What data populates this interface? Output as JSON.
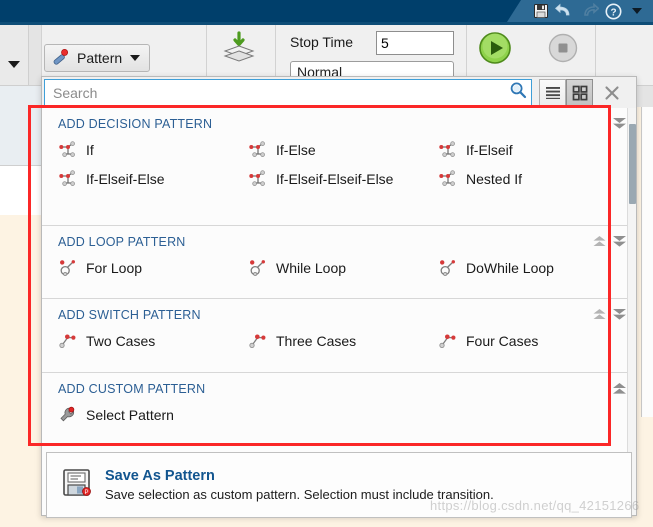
{
  "titlebar": {
    "quick_access": [
      {
        "name": "save-icon",
        "label": "Save"
      },
      {
        "name": "undo-icon",
        "label": "Undo"
      },
      {
        "name": "redo-icon",
        "label": "Redo"
      },
      {
        "name": "help-icon",
        "label": "Help"
      },
      {
        "name": "chevron-down-icon",
        "label": "More"
      }
    ]
  },
  "toolbar": {
    "pattern_button": "Pattern",
    "stop_time_label": "Stop Time",
    "stop_time_value": "5",
    "sim_mode_value": "Normal",
    "update_icon": "update-model-icon",
    "run_icon": "run-icon",
    "stop_icon": "stop-icon",
    "rail_caret": "chevron-down-icon"
  },
  "search": {
    "placeholder": "Search",
    "value": "Search",
    "search_icon": "search-icon",
    "list_view_icon": "list-view-icon",
    "grid_view_icon": "grid-view-icon",
    "close_icon": "close-icon",
    "active_view": "grid"
  },
  "gallery": {
    "sections": [
      {
        "title": "ADD DECISION PATTERN",
        "icon": "decision-pattern-icon",
        "chevrons": [
          "collapse-all-down-icon"
        ],
        "items": [
          {
            "label": "If"
          },
          {
            "label": "If-Else"
          },
          {
            "label": "If-Elseif"
          },
          {
            "label": "If-Elseif-Else"
          },
          {
            "label": "If-Elseif-Elseif-Else"
          },
          {
            "label": "Nested If"
          }
        ]
      },
      {
        "title": "ADD LOOP PATTERN",
        "icon": "loop-pattern-icon",
        "chevrons": [
          "expand-up-icon",
          "collapse-down-icon"
        ],
        "items": [
          {
            "label": "For Loop"
          },
          {
            "label": "While Loop"
          },
          {
            "label": "DoWhile Loop"
          }
        ]
      },
      {
        "title": "ADD SWITCH PATTERN",
        "icon": "switch-pattern-icon",
        "chevrons": [
          "expand-up-icon",
          "collapse-down-icon"
        ],
        "items": [
          {
            "label": "Two Cases"
          },
          {
            "label": "Three Cases"
          },
          {
            "label": "Four Cases"
          }
        ]
      },
      {
        "title": "ADD CUSTOM PATTERN",
        "icon": "custom-pattern-icon",
        "chevrons": [
          "expand-up-icon"
        ],
        "items": [
          {
            "label": "Select Pattern"
          }
        ]
      }
    ]
  },
  "footer": {
    "icon": "save-as-pattern-icon",
    "title": "Save As Pattern",
    "subtitle": "Save selection as custom pattern. Selection must include transition."
  },
  "watermark": "https://blog.csdn.net/qq_42151266",
  "colors": {
    "titlebar": "#003f6b",
    "accent_link": "#12558f",
    "section_heading": "#2c5f94",
    "highlight_rect": "#fb2727",
    "search_border": "#3f9fd8"
  }
}
